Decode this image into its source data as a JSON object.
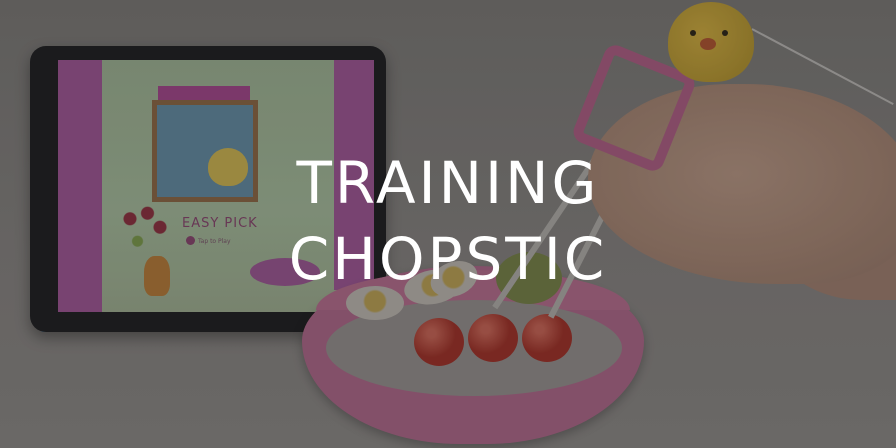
{
  "banner": {
    "headline_line1": "TRAINING",
    "headline_line2": "CHOPSTIC"
  },
  "tablet_screen": {
    "caption": "EASY PICK",
    "sub_caption": "Tap to Play"
  },
  "colors": {
    "headline": "#ffffff",
    "tray": "#9c5d7c",
    "overlay": "rgba(20,20,20,0.18)"
  }
}
